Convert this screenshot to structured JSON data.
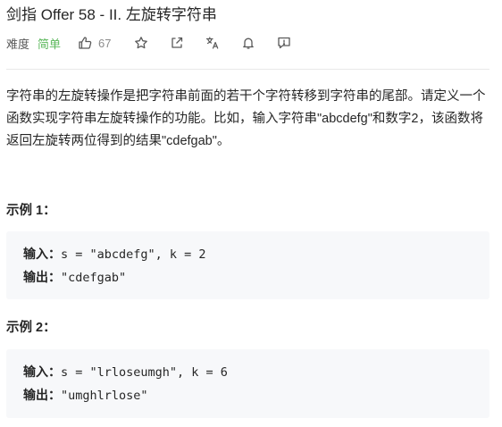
{
  "problem": {
    "title": "剑指 Offer 58 - II. 左旋转字符串",
    "difficulty_label": "难度",
    "difficulty": "简单",
    "likes": "67",
    "difficulty_color": "#5cb85c"
  },
  "icons": [
    "thumbs-up-icon",
    "star-icon",
    "share-icon",
    "translate-icon",
    "bell-icon",
    "feedback-icon"
  ],
  "description": "字符串的左旋转操作是把字符串前面的若干个字符转移到字符串的尾部。请定义一个函数实现字符串左旋转操作的功能。比如，输入字符串\"abcdefg\"和数字2，该函数将返回左旋转两位得到的结果\"cdefgab\"。",
  "examples": [
    {
      "heading": "示例 1：",
      "input_label": "输入：",
      "input": "s = \"abcdefg\", k = 2",
      "output_label": "输出：",
      "output": "\"cdefgab\""
    },
    {
      "heading": "示例 2：",
      "input_label": "输入：",
      "input": "s = \"lrloseumgh\", k = 6",
      "output_label": "输出：",
      "output": "\"umghlrlose\""
    }
  ]
}
